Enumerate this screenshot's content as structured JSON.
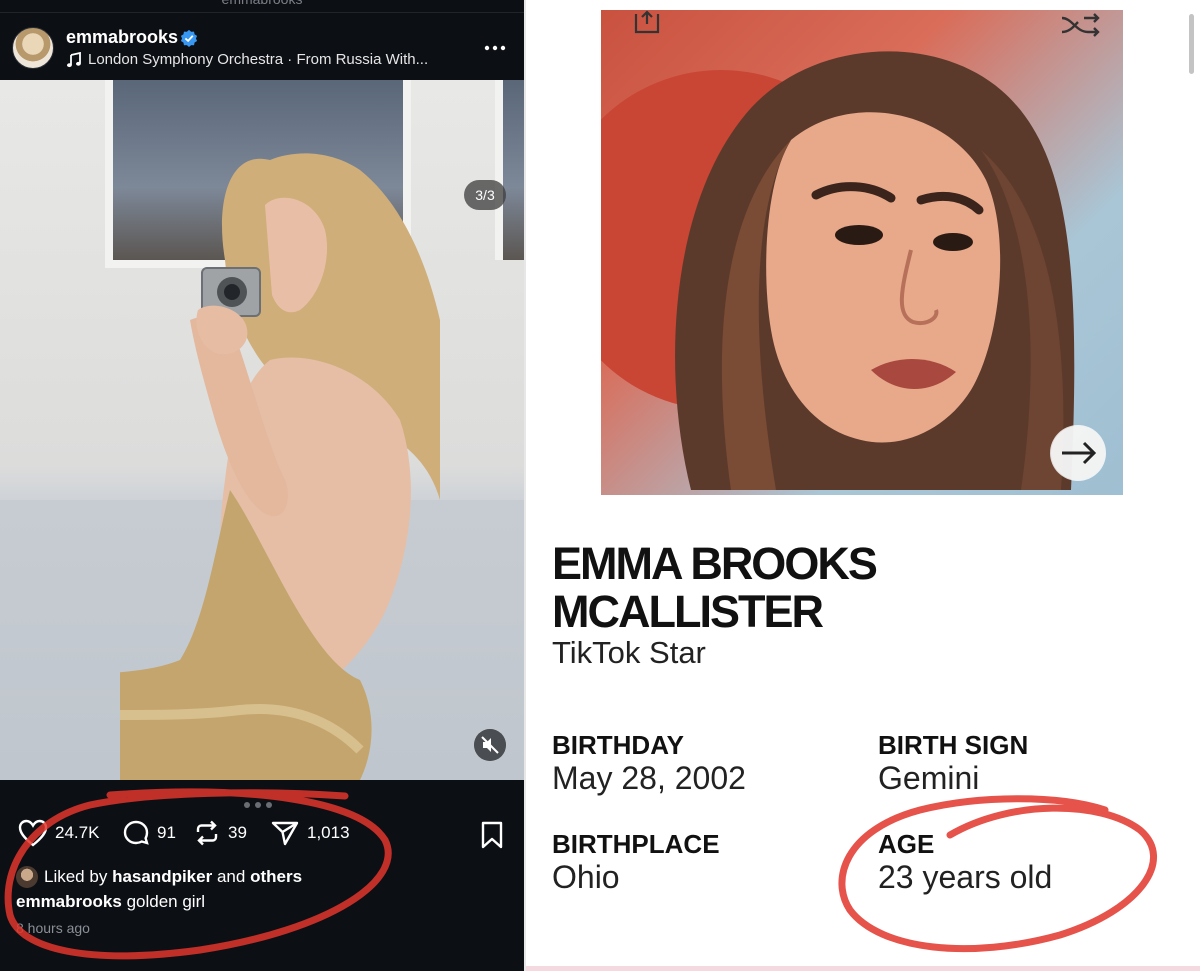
{
  "left_post": {
    "top_strip_text": "emmabrooks",
    "username": "emmabrooks",
    "music": "London Symphony Orchestra · From Russia With...",
    "counter": "3/3",
    "likes": "24.7K",
    "comments": "91",
    "reposts": "39",
    "shares": "1,013",
    "liked_by_prefix": "Liked by",
    "liked_by_user": "hasandpiker",
    "liked_by_and": "and",
    "liked_by_others": "others",
    "caption_user": "emmabrooks",
    "caption_text": "golden girl",
    "time": "8 hours ago"
  },
  "profile": {
    "name_line1": "EMMA BROOKS",
    "name_line2": "MCALLISTER",
    "occupation": "TikTok Star",
    "birthday_label": "BIRTHDAY",
    "birthday_value": "May 28, 2002",
    "birth_sign_label": "BIRTH SIGN",
    "birth_sign_value": "Gemini",
    "birthplace_label": "BIRTHPLACE",
    "birthplace_value": "Ohio",
    "age_label": "AGE",
    "age_value": "23 years old"
  },
  "colors": {
    "verified": "#3897f0",
    "annotation_red": "#e0352b",
    "dark_bg": "#0c0f14"
  },
  "icons": [
    "verified-badge-icon",
    "music-note-icon",
    "more-icon",
    "heart-icon",
    "comment-icon",
    "repost-icon",
    "share-icon",
    "bookmark-icon",
    "mute-icon",
    "upload-icon",
    "shuffle-icon",
    "arrow-right-icon"
  ]
}
